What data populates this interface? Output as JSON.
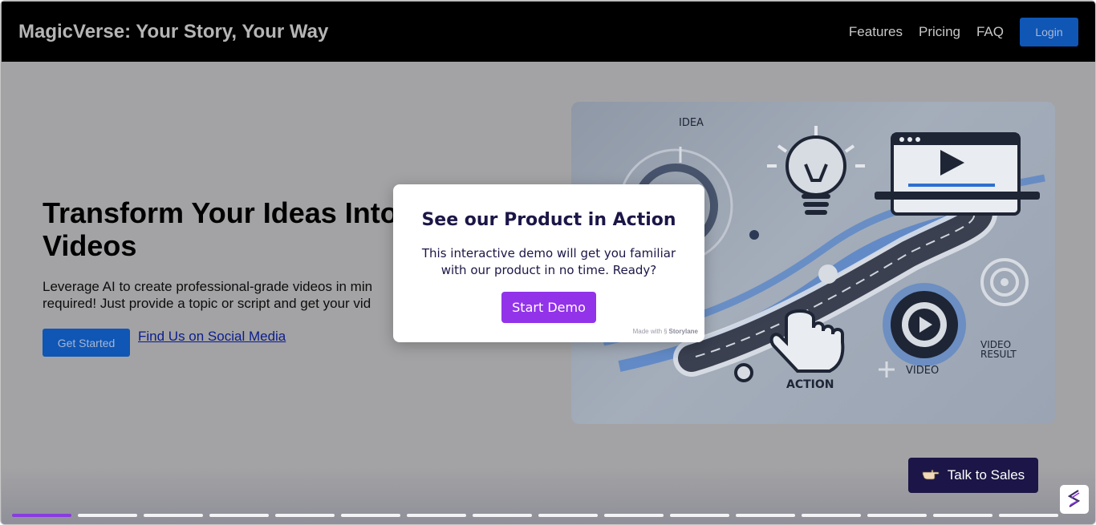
{
  "header": {
    "brand": "MagicVerse: Your Story, Your Way",
    "nav": [
      "Features",
      "Pricing",
      "FAQ"
    ],
    "login_label": "Login"
  },
  "hero": {
    "title": "Transform Your Ideas Into\nVideos",
    "text_line1": "Leverage AI to create professional-grade videos in min",
    "text_line2": "required! Just provide a topic or script and get your vid",
    "get_started_label": "Get Started",
    "social_link_label": "Find Us on Social Media",
    "image": {
      "label_idea": "IDEA",
      "label_action": "ACTION",
      "label_video": "VIDEO",
      "label_result_line1": "VIDEO",
      "label_result_line2": "RESULT"
    }
  },
  "modal": {
    "title": "See our Product in Action",
    "text": "This interactive demo will get you familiar with our product in no time. Ready?",
    "start_label": "Start Demo",
    "made_with": "Made with",
    "made_with_brand": "Storylane"
  },
  "talk_sales_label": "Talk to Sales",
  "progress": {
    "total_steps": 16,
    "current_step": 1
  },
  "colors": {
    "accent_purple": "#9233ea",
    "navy": "#1b1647",
    "login_blue": "#0f56b5",
    "overlay_gray": "#a3a3a5"
  }
}
